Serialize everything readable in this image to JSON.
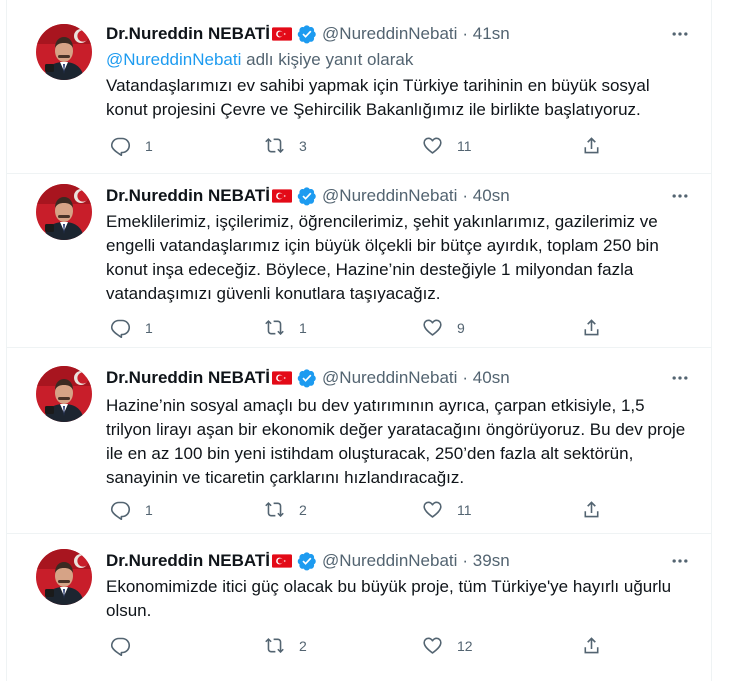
{
  "colors": {
    "text": "#0f1419",
    "secondary": "#536471",
    "link": "#1d9bf0",
    "verified": "#1d9bf0",
    "flag_red": "#e30a17"
  },
  "icons": {
    "more": "more-icon",
    "reply": "reply-icon",
    "retweet": "retweet-icon",
    "like": "like-icon",
    "share": "share-icon",
    "verified": "verified-badge-icon",
    "flag": "turkey-flag-icon"
  },
  "tweets": [
    {
      "name": "Dr.Nureddin NEBATİ",
      "handle": "@NureddinNebati",
      "time": "· 41sn",
      "reply_to_handle": "@NureddinNebati",
      "reply_to_suffix": " adlı kişiye yanıt olarak",
      "text": "Vatandaşlarımızı ev sahibi yapmak için Türkiye tarihinin en büyük sosyal konut projesini Çevre ve Şehircilik Bakanlığımız ile birlikte başlatıyoruz.",
      "replies": "1",
      "retweets": "3",
      "likes": "11"
    },
    {
      "name": "Dr.Nureddin NEBATİ",
      "handle": "@NureddinNebati",
      "time": "· 40sn",
      "text": "Emeklilerimiz, işçilerimiz, öğrencilerimiz, şehit yakınlarımız, gazilerimiz ve engelli vatandaşlarımız için büyük ölçekli bir bütçe ayırdık, toplam 250 bin konut inşa edeceğiz. Böylece, Hazine’nin desteğiyle 1 milyondan fazla vatandaşımızı güvenli konutlara taşıyacağız.",
      "replies": "1",
      "retweets": "1",
      "likes": "9"
    },
    {
      "name": "Dr.Nureddin NEBATİ",
      "handle": "@NureddinNebati",
      "time": "· 40sn",
      "text": "Hazine’nin sosyal amaçlı bu dev yatırımının ayrıca, çarpan etkisiyle, 1,5 trilyon lirayı aşan bir ekonomik değer yaratacağını öngörüyoruz. Bu dev proje ile en az 100 bin yeni istihdam oluşturacak, 250’den fazla alt sektörün, sanayinin ve ticaretin çarklarını hızlandıracağız.",
      "replies": "1",
      "retweets": "2",
      "likes": "11"
    },
    {
      "name": "Dr.Nureddin NEBATİ",
      "handle": "@NureddinNebati",
      "time": "· 39sn",
      "text": "Ekonomimizde itici güç olacak bu büyük proje, tüm Türkiye'ye hayırlı uğurlu olsun.",
      "replies": "",
      "retweets": "2",
      "likes": "12"
    }
  ]
}
